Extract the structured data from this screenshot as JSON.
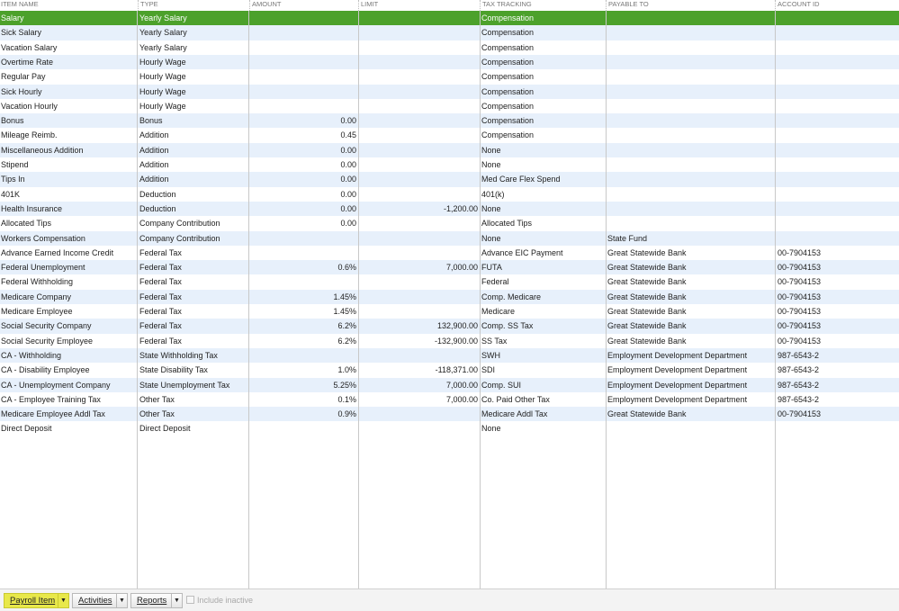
{
  "columns": {
    "name": "ITEM NAME",
    "type": "TYPE",
    "amount": "AMOUNT",
    "limit": "LIMIT",
    "tax_tracking": "TAX TRACKING",
    "payable_to": "PAYABLE TO",
    "account_id": "ACCOUNT ID"
  },
  "rows": [
    {
      "name": "Salary",
      "type": "Yearly Salary",
      "amount": "",
      "limit": "",
      "tax_tracking": "Compensation",
      "payable_to": "",
      "account_id": "",
      "selected": true
    },
    {
      "name": "Sick Salary",
      "type": "Yearly Salary",
      "amount": "",
      "limit": "",
      "tax_tracking": "Compensation",
      "payable_to": "",
      "account_id": ""
    },
    {
      "name": "Vacation Salary",
      "type": "Yearly Salary",
      "amount": "",
      "limit": "",
      "tax_tracking": "Compensation",
      "payable_to": "",
      "account_id": ""
    },
    {
      "name": "Overtime Rate",
      "type": "Hourly Wage",
      "amount": "",
      "limit": "",
      "tax_tracking": "Compensation",
      "payable_to": "",
      "account_id": ""
    },
    {
      "name": "Regular Pay",
      "type": "Hourly Wage",
      "amount": "",
      "limit": "",
      "tax_tracking": "Compensation",
      "payable_to": "",
      "account_id": ""
    },
    {
      "name": "Sick Hourly",
      "type": "Hourly Wage",
      "amount": "",
      "limit": "",
      "tax_tracking": "Compensation",
      "payable_to": "",
      "account_id": ""
    },
    {
      "name": "Vacation Hourly",
      "type": "Hourly Wage",
      "amount": "",
      "limit": "",
      "tax_tracking": "Compensation",
      "payable_to": "",
      "account_id": ""
    },
    {
      "name": "Bonus",
      "type": "Bonus",
      "amount": "0.00",
      "limit": "",
      "tax_tracking": "Compensation",
      "payable_to": "",
      "account_id": ""
    },
    {
      "name": "Mileage Reimb.",
      "type": "Addition",
      "amount": "0.45",
      "limit": "",
      "tax_tracking": "Compensation",
      "payable_to": "",
      "account_id": ""
    },
    {
      "name": "Miscellaneous Addition",
      "type": "Addition",
      "amount": "0.00",
      "limit": "",
      "tax_tracking": "None",
      "payable_to": "",
      "account_id": ""
    },
    {
      "name": "Stipend",
      "type": "Addition",
      "amount": "0.00",
      "limit": "",
      "tax_tracking": "None",
      "payable_to": "",
      "account_id": ""
    },
    {
      "name": "Tips In",
      "type": "Addition",
      "amount": "0.00",
      "limit": "",
      "tax_tracking": "Med Care Flex Spend",
      "payable_to": "",
      "account_id": ""
    },
    {
      "name": "401K",
      "type": "Deduction",
      "amount": "0.00",
      "limit": "",
      "tax_tracking": "401(k)",
      "payable_to": "",
      "account_id": ""
    },
    {
      "name": "Health Insurance",
      "type": "Deduction",
      "amount": "0.00",
      "limit": "-1,200.00",
      "tax_tracking": "None",
      "payable_to": "",
      "account_id": ""
    },
    {
      "name": "Allocated Tips",
      "type": "Company Contribution",
      "amount": "0.00",
      "limit": "",
      "tax_tracking": "Allocated Tips",
      "payable_to": "",
      "account_id": ""
    },
    {
      "name": "Workers Compensation",
      "type": "Company Contribution",
      "amount": "",
      "limit": "",
      "tax_tracking": "None",
      "payable_to": "State Fund",
      "account_id": ""
    },
    {
      "name": "Advance Earned Income Credit",
      "type": "Federal Tax",
      "amount": "",
      "limit": "",
      "tax_tracking": "Advance EIC Payment",
      "payable_to": "Great Statewide Bank",
      "account_id": "00-7904153"
    },
    {
      "name": "Federal Unemployment",
      "type": "Federal Tax",
      "amount": "0.6%",
      "limit": "7,000.00",
      "tax_tracking": "FUTA",
      "payable_to": "Great Statewide Bank",
      "account_id": "00-7904153"
    },
    {
      "name": "Federal Withholding",
      "type": "Federal Tax",
      "amount": "",
      "limit": "",
      "tax_tracking": "Federal",
      "payable_to": "Great Statewide Bank",
      "account_id": "00-7904153"
    },
    {
      "name": "Medicare Company",
      "type": "Federal Tax",
      "amount": "1.45%",
      "limit": "",
      "tax_tracking": "Comp. Medicare",
      "payable_to": "Great Statewide Bank",
      "account_id": "00-7904153"
    },
    {
      "name": "Medicare Employee",
      "type": "Federal Tax",
      "amount": "1.45%",
      "limit": "",
      "tax_tracking": "Medicare",
      "payable_to": "Great Statewide Bank",
      "account_id": "00-7904153"
    },
    {
      "name": "Social Security Company",
      "type": "Federal Tax",
      "amount": "6.2%",
      "limit": "132,900.00",
      "tax_tracking": "Comp. SS Tax",
      "payable_to": "Great Statewide Bank",
      "account_id": "00-7904153"
    },
    {
      "name": "Social Security Employee",
      "type": "Federal Tax",
      "amount": "6.2%",
      "limit": "-132,900.00",
      "tax_tracking": "SS Tax",
      "payable_to": "Great Statewide Bank",
      "account_id": "00-7904153"
    },
    {
      "name": "CA - Withholding",
      "type": "State Withholding Tax",
      "amount": "",
      "limit": "",
      "tax_tracking": "SWH",
      "payable_to": "Employment Development Department",
      "account_id": "987-6543-2"
    },
    {
      "name": "CA - Disability Employee",
      "type": "State Disability Tax",
      "amount": "1.0%",
      "limit": "-118,371.00",
      "tax_tracking": "SDI",
      "payable_to": "Employment Development Department",
      "account_id": "987-6543-2"
    },
    {
      "name": "CA - Unemployment Company",
      "type": "State Unemployment Tax",
      "amount": "5.25%",
      "limit": "7,000.00",
      "tax_tracking": "Comp. SUI",
      "payable_to": "Employment Development Department",
      "account_id": "987-6543-2"
    },
    {
      "name": "CA - Employee Training Tax",
      "type": "Other Tax",
      "amount": "0.1%",
      "limit": "7,000.00",
      "tax_tracking": "Co. Paid Other Tax",
      "payable_to": "Employment Development Department",
      "account_id": "987-6543-2"
    },
    {
      "name": "Medicare Employee Addl Tax",
      "type": "Other Tax",
      "amount": "0.9%",
      "limit": "",
      "tax_tracking": "Medicare Addl Tax",
      "payable_to": "Great Statewide Bank",
      "account_id": "00-7904153"
    },
    {
      "name": "Direct Deposit",
      "type": "Direct Deposit",
      "amount": "",
      "limit": "",
      "tax_tracking": "None",
      "payable_to": "",
      "account_id": ""
    }
  ],
  "footer": {
    "payroll_item_label": "Payroll Item",
    "activities_label": "Activities",
    "reports_label": "Reports",
    "include_inactive_label": "Include inactive",
    "include_inactive_checked": false
  },
  "colors": {
    "selected_row": "#4ca12b",
    "alt_row": "#e7f0fb",
    "highlight_button": "#e8e84a"
  }
}
